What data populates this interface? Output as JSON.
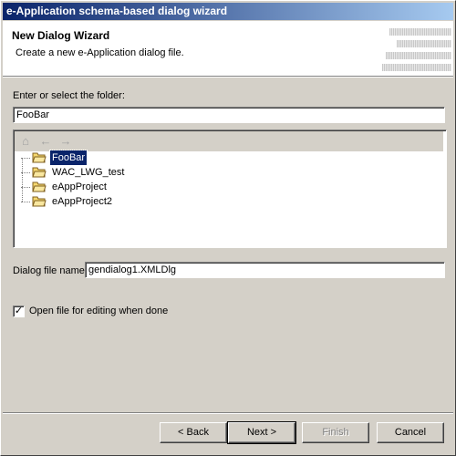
{
  "window": {
    "title": "e-Application schema-based dialog wizard"
  },
  "header": {
    "title": "New Dialog Wizard",
    "description": "Create a new e-Application dialog file."
  },
  "folder": {
    "label": "Enter or select the folder:",
    "value": "FooBar"
  },
  "tree": {
    "toolbar": {
      "home_icon": "home-icon",
      "back_icon": "back-arrow-icon",
      "forward_icon": "forward-arrow-icon"
    },
    "items": [
      {
        "label": "FooBar",
        "selected": true
      },
      {
        "label": "WAC_LWG_test"
      },
      {
        "label": "eAppProject"
      },
      {
        "label": "eAppProject2"
      }
    ]
  },
  "filename": {
    "label": "Dialog file name",
    "value": "gendialog1.XMLDlg"
  },
  "open_editing": {
    "label": "Open file for editing when done",
    "checked": true
  },
  "buttons": {
    "back": "< Back",
    "next": "Next >",
    "finish": "Finish",
    "cancel": "Cancel"
  }
}
